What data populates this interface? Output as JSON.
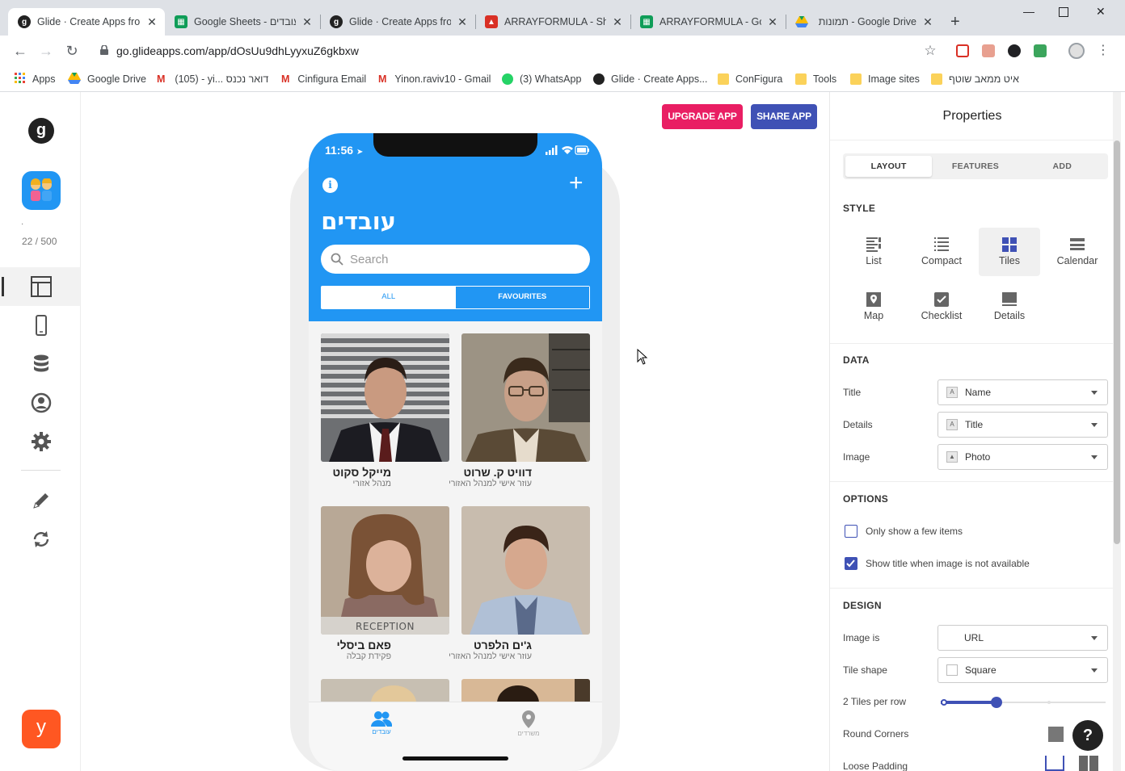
{
  "tabs": [
    {
      "title": "Glide · Create Apps from",
      "icon": "glide-icon",
      "active": true
    },
    {
      "title": "Google Sheets - עובדים",
      "icon": "sheets-icon"
    },
    {
      "title": "Glide · Create Apps from",
      "icon": "glide-icon"
    },
    {
      "title": "ARRAYFORMULA - Shee",
      "icon": "arrayformula-icon"
    },
    {
      "title": "ARRAYFORMULA - Goo",
      "icon": "sheets-icon"
    },
    {
      "title": "תמונות - Google Drive",
      "icon": "drive-icon"
    }
  ],
  "address": "go.glideapps.com/app/dOsUu9dhLyyxuZ6gkbxw",
  "bookmarks": [
    {
      "label": "Apps",
      "icon": "apps-grid-icon"
    },
    {
      "label": "Google Drive",
      "icon": "drive-icon"
    },
    {
      "label": "(105) - yi... דואר נכנס",
      "icon": "gmail-icon"
    },
    {
      "label": "Cinfigura Email",
      "icon": "gmail-icon"
    },
    {
      "label": "Yinon.raviv10 - Gmail",
      "icon": "gmail-icon"
    },
    {
      "label": "(3) WhatsApp",
      "icon": "whatsapp-icon"
    },
    {
      "label": "Glide · Create Apps...",
      "icon": "glide-icon"
    },
    {
      "label": "ConFigura",
      "icon": "folder-icon"
    },
    {
      "label": "Tools",
      "icon": "folder-icon"
    },
    {
      "label": "Image sites",
      "icon": "folder-icon"
    },
    {
      "label": "איט ממאב שוטף",
      "icon": "folder-icon"
    }
  ],
  "leftnav": {
    "dot": "·",
    "rows": "22 / 500",
    "y": "y"
  },
  "actions": {
    "upgrade": "UPGRADE APP",
    "share": "SHARE APP"
  },
  "phone": {
    "time": "11:56",
    "title": "עובדים",
    "search_placeholder": "Search",
    "seg_all": "ALL",
    "seg_fav": "FAVOURITES",
    "tiles": [
      {
        "title": "מייקל סקוט",
        "detail": "מנהל אזורי"
      },
      {
        "title": "דוויט ק. שרוט",
        "detail": "עוזר אישי למנהל האזורי"
      },
      {
        "title": "פאם ביסלי",
        "detail": "פקידת קבלה",
        "sign": "RECEPTION"
      },
      {
        "title": "ג'ים הלפרט",
        "detail": "עוזר אישי למנהל האזורי"
      }
    ],
    "nav_people": "עובדים",
    "nav_places": "משרדים"
  },
  "props": {
    "title": "Properties",
    "tabs": [
      "LAYOUT",
      "FEATURES",
      "ADD"
    ],
    "style_header": "STYLE",
    "styles": [
      "List",
      "Compact",
      "Tiles",
      "Calendar",
      "Map",
      "Checklist",
      "Details"
    ],
    "data_header": "DATA",
    "data": [
      {
        "label": "Title",
        "value": "Name"
      },
      {
        "label": "Details",
        "value": "Title"
      },
      {
        "label": "Image",
        "value": "Photo"
      }
    ],
    "options_header": "OPTIONS",
    "opt_few": "Only show a few items",
    "opt_title": "Show title when image is not available",
    "design_header": "DESIGN",
    "image_is_label": "Image is",
    "image_is_value": "URL",
    "tile_shape_label": "Tile shape",
    "tile_shape_value": "Square",
    "tiles_per_row": "2 Tiles per row",
    "tiles_per_row_value": 2,
    "round_corners": "Round Corners",
    "loose_padding": "Loose Padding"
  },
  "help": "?"
}
